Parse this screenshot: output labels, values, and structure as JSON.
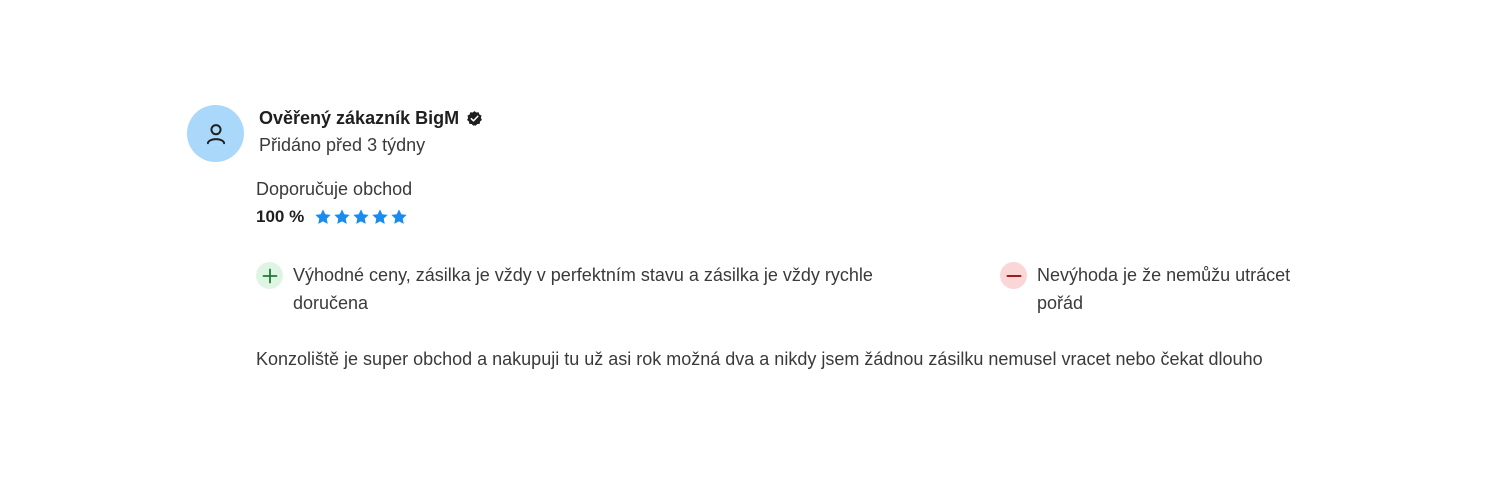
{
  "review": {
    "author": "Ověřený zákazník BigM",
    "added": "Přidáno před 3 týdny",
    "recommend_label": "Doporučuje obchod",
    "recommend_percent": "100 %",
    "stars": 5,
    "star_color": "#1a8cf0",
    "pro_text": "Výhodné ceny, zásilka je vždy v perfektním stavu a zásilka je vždy rychle doručena",
    "con_text": "Nevýhoda je že nemůžu utrácet pořád",
    "body": "Konzoliště je super obchod a nakupuji tu už asi rok možná dva a nikdy jsem žádnou zásilku nemusel vracet nebo čekat dlouho",
    "icons": {
      "avatar": "user-icon",
      "verified": "verified-check-icon",
      "pro": "plus-icon",
      "con": "minus-icon"
    },
    "colors": {
      "avatar_bg": "#a9d8fa",
      "pro_badge": "#dff5e4",
      "pro_icon": "#1e7a35",
      "con_badge": "#fbd6d6",
      "con_icon": "#9b1c1c"
    }
  }
}
